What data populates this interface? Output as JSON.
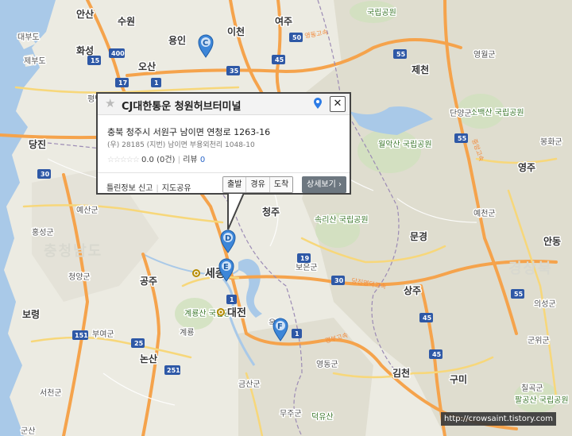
{
  "map": {
    "province_labels": [
      "충청남도",
      "경상북"
    ],
    "cities": [
      "안산",
      "수원",
      "용인",
      "이천",
      "여주",
      "화성",
      "오산",
      "당진",
      "세종",
      "공주",
      "대전",
      "청주",
      "상주",
      "김천",
      "구미",
      "제천",
      "영주",
      "문경",
      "안동",
      "논산",
      "보령"
    ],
    "counties": [
      "대부도",
      "제부도",
      "평택",
      "예산군",
      "홍성군",
      "청양군",
      "부여군",
      "서천군",
      "계룡",
      "옥천",
      "보은군",
      "영동군",
      "금산군",
      "무주군",
      "단양군",
      "봉화군",
      "예천군",
      "의성군",
      "군위군",
      "칠곡군",
      "영월군",
      "군산"
    ],
    "parks": [
      "국립공원",
      "월악산 국립공원",
      "소백산 국립공원",
      "속리산 국립공원",
      "계룡산 국립공원",
      "팔공산 국립공원",
      "덕유산"
    ],
    "routes": [
      "15",
      "400",
      "17",
      "1",
      "50",
      "45",
      "35",
      "30",
      "19",
      "25",
      "151",
      "251",
      "55"
    ],
    "expressways": [
      "영동고속",
      "중앙고속",
      "경부고속",
      "당진영덕고속"
    ],
    "markers": [
      "C",
      "D",
      "E",
      "F"
    ]
  },
  "popup": {
    "title": "CJ대한통운 청원허브터미널",
    "address": "충북 청주시 서원구 남이면 연청로 1263-16",
    "jibun": "(우) 28185 (지번) 남이면 부용외천리 1048-10",
    "stars": "☆☆☆☆☆",
    "rating_text": "0.0 (0건)",
    "review_label": "리뷰",
    "review_count": "0",
    "report_link": "틀린정보 신고",
    "share_link": "지도공유",
    "btn_depart": "출발",
    "btn_via": "경유",
    "btn_arrive": "도착",
    "btn_detail": "상세보기 ›",
    "close": "✕"
  },
  "watermark": "http://crowsaint.tistory.com"
}
